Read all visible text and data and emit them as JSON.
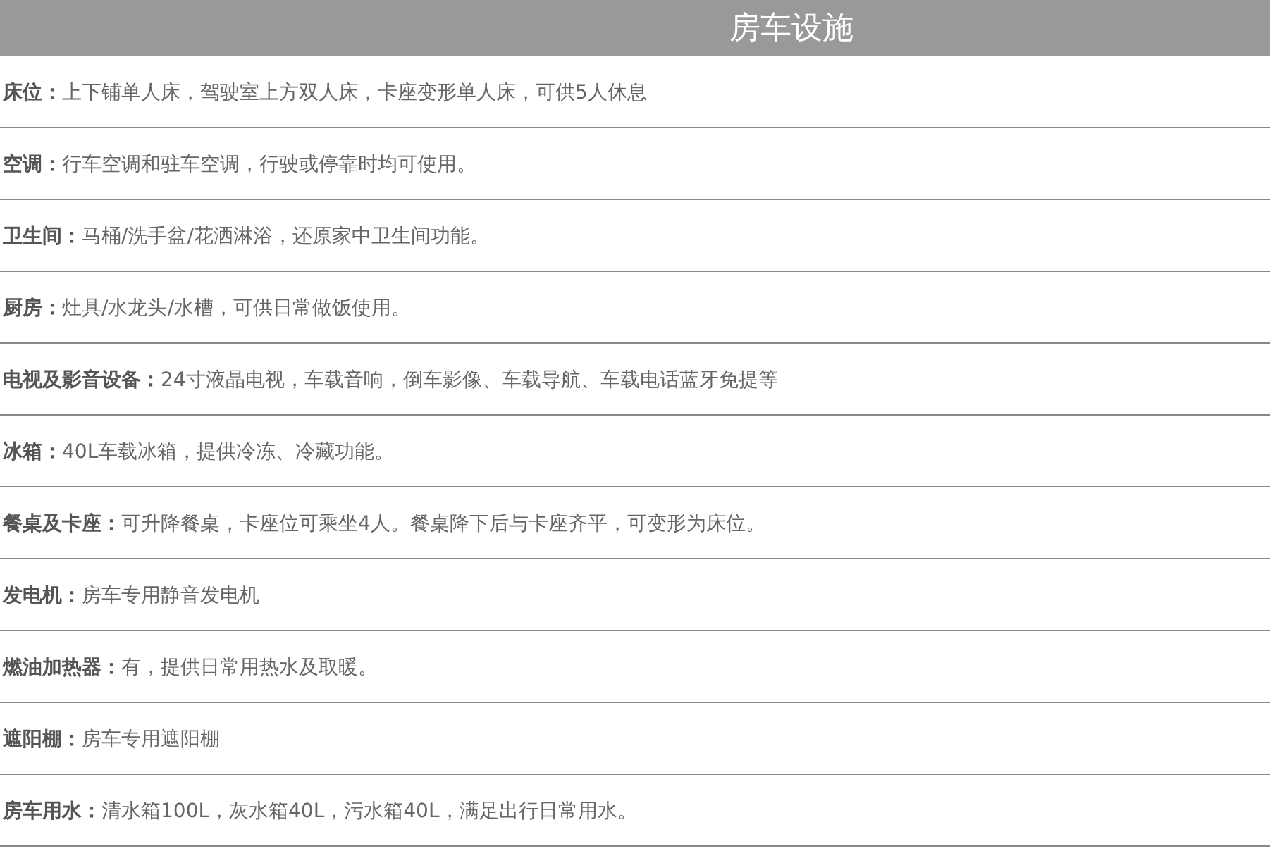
{
  "header": {
    "title": "房车设施"
  },
  "items": [
    {
      "text": "**床位：**上下铺单人床，驾驶室上方双人床，卡座变形单人床，可供5人休息"
    },
    {
      "text": "**空调：**行车空调和驻车空调，行驶或停靠时均可使用。"
    },
    {
      "text": "**卫生间：**马桶/洗手盆/花洒淋浴，还原家中卫生间功能。"
    },
    {
      "text": "**厨房：**灶具/水龙头/水槽，可供日常做饭使用。"
    },
    {
      "text": "**电视及影音设备：**24寸液晶电视，车载音响，倒车影像、车载导航、车载电话蓝牙免提等"
    },
    {
      "text": "**冰箱：**40L车载冰箱，提供冷冻、冷藏功能。"
    },
    {
      "text": "**餐桌及卡座：**可升降餐桌，卡座位可乘坐4人。餐桌降下后与卡座齐平，可变形为床位。"
    },
    {
      "text": "**发电机：**房车专用静音发电机"
    },
    {
      "text": "**燃油加热器：**有，提供日常用热水及取暖。"
    },
    {
      "text": "**遮阳棚：**房车专用遮阳棚"
    },
    {
      "text": "**房车用水：**清水箱100L，灰水箱40L，污水箱40L，满足出行日常用水。"
    }
  ]
}
